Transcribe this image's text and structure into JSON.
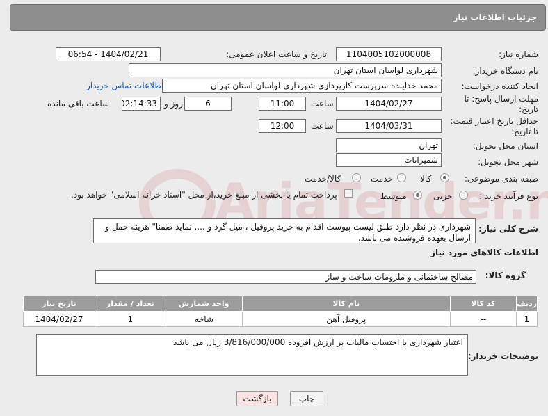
{
  "header": {
    "title": "جزئیات اطلاعات نیاز"
  },
  "fields": {
    "need_number_label": "شماره نیاز:",
    "need_number": "1104005102000008",
    "announce_label": "تاریخ و ساعت اعلان عمومی:",
    "announce_value": "1404/02/21 - 06:54",
    "buyer_org_label": "نام دستگاه خریدار:",
    "buyer_org": "شهرداری لواسان استان تهران",
    "creator_label": "ایجاد کننده درخواست:",
    "creator": "محمد خداینده سرپرست کارپردازی شهرداری لواسان استان تهران",
    "contact_link": "اطلاعات تماس خریدار",
    "reply_deadline_label_1": "مهلت ارسال پاسخ: تا",
    "reply_deadline_label_2": "تاریخ:",
    "reply_date": "1404/02/27",
    "time_label": "ساعت",
    "reply_time": "11:00",
    "days_value": "6",
    "days_label": "روز و",
    "remaining_time": "02:14:33",
    "remaining_label": "ساعت باقی مانده",
    "price_validity_label_1": "حداقل تاریخ اعتبار قیمت:",
    "price_validity_label_2": "تا تاریخ:",
    "price_date": "1404/03/31",
    "price_time": "12:00",
    "province_label": "استان محل تحویل:",
    "province": "تهران",
    "city_label": "شهر محل تحویل:",
    "city": "شمیرانات",
    "category_label": "طبقه بندی موضوعی:",
    "category_options": [
      "کالا",
      "خدمت",
      "کالا/خدمت"
    ],
    "process_label": "نوع فرآیند خرید :",
    "process_options": [
      "جزیی",
      "متوسط"
    ],
    "payment_note": "پرداخت تمام یا بخشی از مبلغ خرید،از محل \"اسناد خزانه اسلامی\" خواهد بود."
  },
  "description": {
    "label": "شرح کلی نیاز:",
    "text": "شهرداری در نظر دارد طبق لیست پیوست اقدام به خرید پروفیل ، میل گرد و .... نماید ضمنا\" هزینه حمل و ارسال بعهده فروشنده می باشد."
  },
  "goods": {
    "section_title": "اطلاعات کالاهای مورد نیاز",
    "group_label": "گروه کالا:",
    "group_value": "مصالح ساختمانی و ملزومات ساخت و ساز",
    "columns": [
      "ردیف",
      "کد کالا",
      "نام کالا",
      "واحد شمارش",
      "تعداد / مقدار",
      "تاریخ نیاز"
    ],
    "rows": [
      [
        "1",
        "--",
        "پروفیل آهن",
        "شاخه",
        "1",
        "1404/02/27"
      ]
    ]
  },
  "buyer_notes": {
    "label": "توضیحات خریدار:",
    "text": "اعتبار شهرداری با احتساب مالیات بر ارزش افزوده 3/816/000/000 ریال می باشد"
  },
  "buttons": {
    "print": "چاپ",
    "back": "بازگشت"
  },
  "watermark": {
    "text": "AriaTender.net"
  }
}
